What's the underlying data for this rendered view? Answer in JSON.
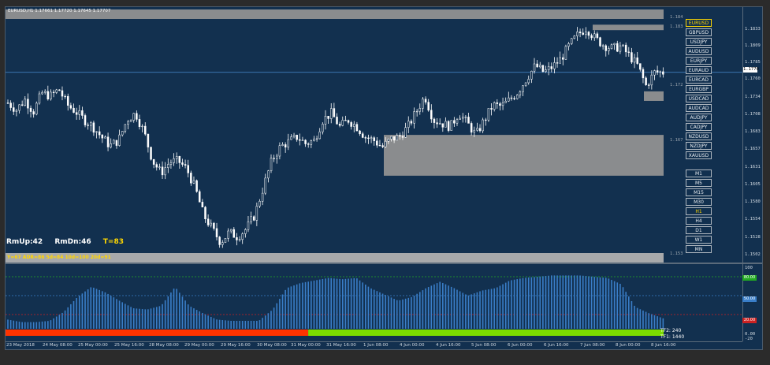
{
  "window": {
    "title": "EURUSD,H1  1.17661 1.17720 1.17645 1.17707"
  },
  "stats": {
    "rm_up": "RmUp:42",
    "rm_dn": "RmDn:46",
    "t_value": "T=83"
  },
  "adr_line": "Y=67  ADR=86  5d=84  10d=100  20d=91",
  "symbols": [
    "EURUSD",
    "GBPUSD",
    "USDJPY",
    "AUDUSD",
    "EURJPY",
    "EURAUD",
    "EURCAD",
    "EURGBP",
    "USDCAD",
    "AUDCAD",
    "AUDJPY",
    "CADJPY",
    "NZDUSD",
    "NZDJPY",
    "XAUUSD"
  ],
  "active_symbol": "EURUSD",
  "timeframes": [
    "M1",
    "M5",
    "M15",
    "M30",
    "H1",
    "H4",
    "D1",
    "W1",
    "MN"
  ],
  "active_timeframe": "H1",
  "price_scale": [
    "1.1833",
    "1.1809",
    "1.1785",
    "1.1760",
    "1.1734",
    "1.1708",
    "1.1683",
    "1.1657",
    "1.1631",
    "1.1605",
    "1.1580",
    "1.1554",
    "1.1528",
    "1.1502"
  ],
  "current_price": "1.1770",
  "zone_labels": [
    "1.184",
    "1.183",
    "1.172",
    "1.167",
    "1.153"
  ],
  "sub_scale": [
    "100",
    "0.00",
    "-20"
  ],
  "sub_levels": [
    "80.00",
    "50.00",
    "20.00"
  ],
  "sub_info": {
    "tf2": "TF2: 240",
    "tf1": "TF1: 1440"
  },
  "time_scale": [
    "23 May 2018",
    "24 May 08:00",
    "25 May 00:00",
    "25 May 16:00",
    "28 May 08:00",
    "29 May 00:00",
    "29 May 16:00",
    "30 May 08:00",
    "31 May 00:00",
    "31 May 16:00",
    "1 Jun 08:00",
    "4 Jun 00:00",
    "4 Jun 16:00",
    "5 Jun 08:00",
    "6 Jun 00:00",
    "6 Jun 16:00",
    "7 Jun 08:00",
    "8 Jun 00:00",
    "8 Jun 16:00"
  ],
  "colors": {
    "background": "#12304f",
    "candles": "#ffffff",
    "zones": "#8a8c8e",
    "histogram": "#3a7ec8",
    "bar_red": "#ff3300",
    "bar_green": "#7cdc00",
    "level_80": "#22aa22",
    "level_50": "#3a7ec8",
    "level_20": "#cc2222",
    "accent": "#ffd700"
  },
  "chart_data": {
    "type": "candlestick",
    "price_path": [
      1.1725,
      1.1715,
      1.173,
      1.1712,
      1.174,
      1.1735,
      1.1745,
      1.1722,
      1.1712,
      1.17,
      1.169,
      1.1675,
      1.1662,
      1.167,
      1.17,
      1.171,
      1.1682,
      1.164,
      1.1622,
      1.1638,
      1.164,
      1.1628,
      1.16,
      1.156,
      1.154,
      1.152,
      1.1535,
      1.1528,
      1.154,
      1.156,
      1.16,
      1.164,
      1.166,
      1.1668,
      1.1675,
      1.1665,
      1.167,
      1.17,
      1.171,
      1.169,
      1.17,
      1.169,
      1.1675,
      1.167,
      1.166,
      1.1672,
      1.1675,
      1.169,
      1.1712,
      1.1735,
      1.17,
      1.1695,
      1.169,
      1.171,
      1.1695,
      1.1678,
      1.17,
      1.1722,
      1.172,
      1.173,
      1.1742,
      1.1762,
      1.178,
      1.177,
      1.1778,
      1.179,
      1.181,
      1.1826,
      1.1835,
      1.182,
      1.181,
      1.1805,
      1.1808,
      1.1795,
      1.178,
      1.175,
      1.177,
      1.177
    ],
    "histogram_path": [
      12,
      8,
      8,
      10,
      24,
      48,
      64,
      55,
      42,
      30,
      28,
      34,
      64,
      34,
      22,
      12,
      10,
      10,
      10,
      28,
      62,
      70,
      74,
      78,
      76,
      78,
      62,
      52,
      42,
      48,
      62,
      72,
      62,
      50,
      58,
      62,
      74,
      78,
      80,
      82,
      82,
      82,
      80,
      78,
      68,
      32,
      22,
      14
    ],
    "bar_split_fraction": 0.46
  },
  "zones": [
    {
      "name": "top-supply",
      "price_top": 1.185,
      "price_bottom": 1.184
    },
    {
      "name": "upper-right-supply",
      "price_top": 1.184,
      "price_bottom": 1.1832
    },
    {
      "name": "right-demand",
      "price_top": 1.1742,
      "price_bottom": 1.1728
    },
    {
      "name": "big-demand",
      "price_top": 1.1678,
      "price_bottom": 1.1618
    },
    {
      "name": "bottom-zone",
      "price_top": 1.1504,
      "price_bottom": 1.1495
    }
  ]
}
